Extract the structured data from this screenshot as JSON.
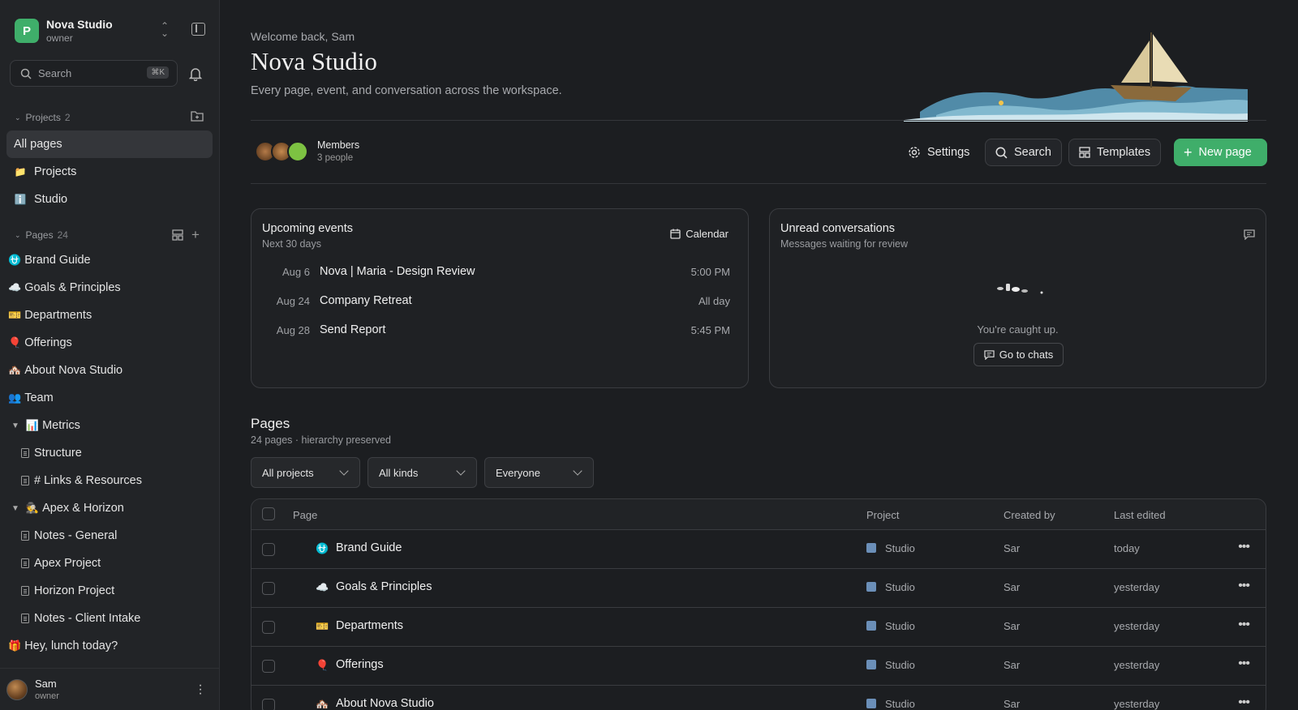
{
  "workspace": {
    "initial": "P",
    "name": "Nova Studio",
    "role": "owner"
  },
  "sidebar": {
    "search_placeholder": "Search",
    "search_shortcut": "⌘K",
    "projects_label": "Projects",
    "projects_count": "2",
    "nav": [
      {
        "label": "All pages",
        "icon": "pages-icon",
        "active": true
      },
      {
        "label": "Projects",
        "icon": "folder-icon"
      },
      {
        "label": "Studio",
        "icon": "info-icon"
      }
    ],
    "pages_label": "Pages",
    "pages_count": "24",
    "pages": [
      {
        "emoji": "⛎",
        "label": "Brand Guide"
      },
      {
        "emoji": "☁️",
        "label": "Goals & Principles"
      },
      {
        "emoji": "🎫",
        "label": "Departments"
      },
      {
        "emoji": "🎈",
        "label": "Offerings"
      },
      {
        "emoji": "🏘️",
        "label": "About Nova Studio"
      },
      {
        "emoji": "👥",
        "label": "Team"
      },
      {
        "emoji": "📊",
        "label": "Metrics",
        "expandable": true
      },
      {
        "label": "Structure",
        "child": true
      },
      {
        "label": "# Links & Resources",
        "child": true
      },
      {
        "emoji": "🕵️",
        "label": "Apex & Horizon",
        "expandable": true
      },
      {
        "label": "Notes - General",
        "child": true
      },
      {
        "label": "Apex Project",
        "child": true
      },
      {
        "label": "Horizon Project",
        "child": true
      },
      {
        "label": "Notes - Client Intake",
        "child": true
      },
      {
        "emoji": "🎁",
        "label": "Hey, lunch today?"
      }
    ],
    "user": {
      "name": "Sam",
      "role": "owner"
    }
  },
  "header": {
    "welcome": "Welcome back, Sam",
    "title": "Nova Studio",
    "subtitle": "Every page, event, and conversation across the workspace."
  },
  "members": {
    "title": "Members",
    "count_text": "3 people"
  },
  "toolbar": {
    "settings": "Settings",
    "search": "Search",
    "templates": "Templates",
    "new_page": "New page"
  },
  "events_card": {
    "title": "Upcoming events",
    "subtitle": "Next 30 days",
    "calendar_label": "Calendar",
    "events": [
      {
        "date": "Aug 6",
        "name": "Nova | Maria - Design Review",
        "time": "5:00 PM"
      },
      {
        "date": "Aug 24",
        "name": "Company Retreat",
        "time": "All day"
      },
      {
        "date": "Aug 28",
        "name": "Send Report",
        "time": "5:45 PM"
      }
    ]
  },
  "conversations_card": {
    "title": "Unread conversations",
    "subtitle": "Messages waiting for review",
    "empty_text": "You're caught up.",
    "go_label": "Go to chats"
  },
  "pages_section": {
    "title": "Pages",
    "subtitle": "24 pages · hierarchy preserved",
    "filters": [
      "All projects",
      "All kinds",
      "Everyone"
    ],
    "columns": {
      "page": "Page",
      "project": "Project",
      "created_by": "Created by",
      "last_edited": "Last edited"
    },
    "rows": [
      {
        "emoji": "⛎",
        "name": "Brand Guide",
        "project": "Studio",
        "created_by": "Sar",
        "last_edited": "today"
      },
      {
        "emoji": "☁️",
        "name": "Goals & Principles",
        "project": "Studio",
        "created_by": "Sar",
        "last_edited": "yesterday"
      },
      {
        "emoji": "🎫",
        "name": "Departments",
        "project": "Studio",
        "created_by": "Sar",
        "last_edited": "yesterday"
      },
      {
        "emoji": "🎈",
        "name": "Offerings",
        "project": "Studio",
        "created_by": "Sar",
        "last_edited": "yesterday"
      },
      {
        "emoji": "🏘️",
        "name": "About Nova Studio",
        "project": "Studio",
        "created_by": "Sar",
        "last_edited": "yesterday"
      }
    ]
  },
  "colors": {
    "accent": "#3fae6a",
    "background": "#1c1e21",
    "sidebar": "#222427"
  }
}
